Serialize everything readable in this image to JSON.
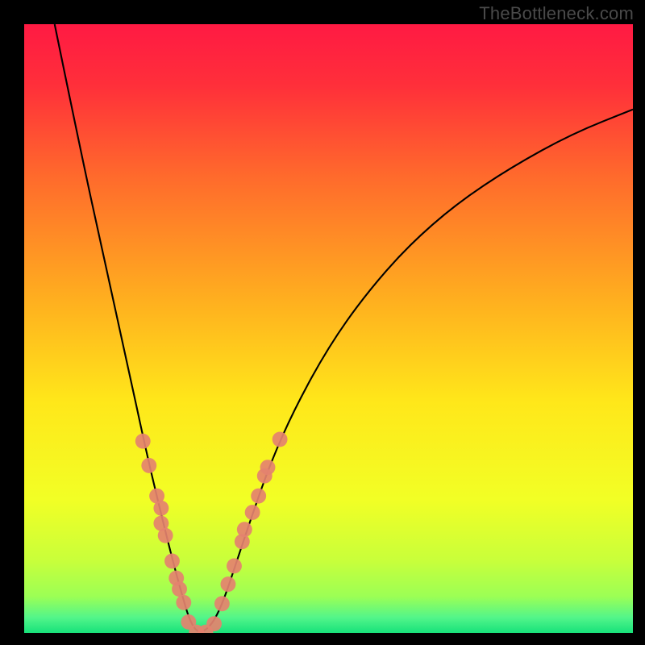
{
  "watermark": {
    "text": "TheBottleneck.com"
  },
  "colors": {
    "frame": "#000000",
    "curve": "#000000",
    "dot_fill": "#e4826f",
    "dot_stroke": "#e4826f",
    "gradient_stops": [
      {
        "offset": 0.0,
        "color": "#ff1a43"
      },
      {
        "offset": 0.1,
        "color": "#ff2f3a"
      },
      {
        "offset": 0.25,
        "color": "#ff6a2c"
      },
      {
        "offset": 0.45,
        "color": "#ffae1f"
      },
      {
        "offset": 0.62,
        "color": "#ffe71a"
      },
      {
        "offset": 0.78,
        "color": "#f2ff25"
      },
      {
        "offset": 0.88,
        "color": "#c9ff3a"
      },
      {
        "offset": 0.94,
        "color": "#9cff55"
      },
      {
        "offset": 0.975,
        "color": "#52f58a"
      },
      {
        "offset": 1.0,
        "color": "#17e27a"
      }
    ]
  },
  "chart_data": {
    "type": "line",
    "title": "",
    "xlabel": "",
    "ylabel": "",
    "xlim": [
      0,
      1
    ],
    "ylim": [
      0,
      1
    ],
    "notes": "V-shaped bottleneck curve. y≈1 is worst (red), y≈0 is best (green). Minimum sits near x≈0.29. Pink dots mark sampled points along the lower flanks of the curve.",
    "series": [
      {
        "name": "bottleneck-curve",
        "x": [
          0.05,
          0.09,
          0.13,
          0.17,
          0.2,
          0.225,
          0.245,
          0.26,
          0.272,
          0.285,
          0.3,
          0.315,
          0.33,
          0.35,
          0.375,
          0.405,
          0.445,
          0.5,
          0.56,
          0.63,
          0.71,
          0.8,
          0.9,
          1.0
        ],
        "y": [
          1.0,
          0.805,
          0.62,
          0.44,
          0.3,
          0.195,
          0.115,
          0.06,
          0.02,
          0.0,
          0.005,
          0.025,
          0.06,
          0.12,
          0.195,
          0.28,
          0.37,
          0.47,
          0.555,
          0.635,
          0.705,
          0.765,
          0.82,
          0.86
        ]
      }
    ],
    "dots": [
      {
        "x": 0.195,
        "y": 0.315
      },
      {
        "x": 0.205,
        "y": 0.275
      },
      {
        "x": 0.218,
        "y": 0.225
      },
      {
        "x": 0.225,
        "y": 0.205
      },
      {
        "x": 0.225,
        "y": 0.18
      },
      {
        "x": 0.232,
        "y": 0.16
      },
      {
        "x": 0.243,
        "y": 0.118
      },
      {
        "x": 0.25,
        "y": 0.09
      },
      {
        "x": 0.255,
        "y": 0.072
      },
      {
        "x": 0.262,
        "y": 0.05
      },
      {
        "x": 0.27,
        "y": 0.018
      },
      {
        "x": 0.283,
        "y": 0.001
      },
      {
        "x": 0.298,
        "y": 0.001
      },
      {
        "x": 0.312,
        "y": 0.015
      },
      {
        "x": 0.325,
        "y": 0.048
      },
      {
        "x": 0.335,
        "y": 0.08
      },
      {
        "x": 0.345,
        "y": 0.11
      },
      {
        "x": 0.358,
        "y": 0.15
      },
      {
        "x": 0.362,
        "y": 0.17
      },
      {
        "x": 0.375,
        "y": 0.198
      },
      {
        "x": 0.385,
        "y": 0.225
      },
      {
        "x": 0.395,
        "y": 0.258
      },
      {
        "x": 0.4,
        "y": 0.272
      },
      {
        "x": 0.42,
        "y": 0.318
      }
    ]
  }
}
